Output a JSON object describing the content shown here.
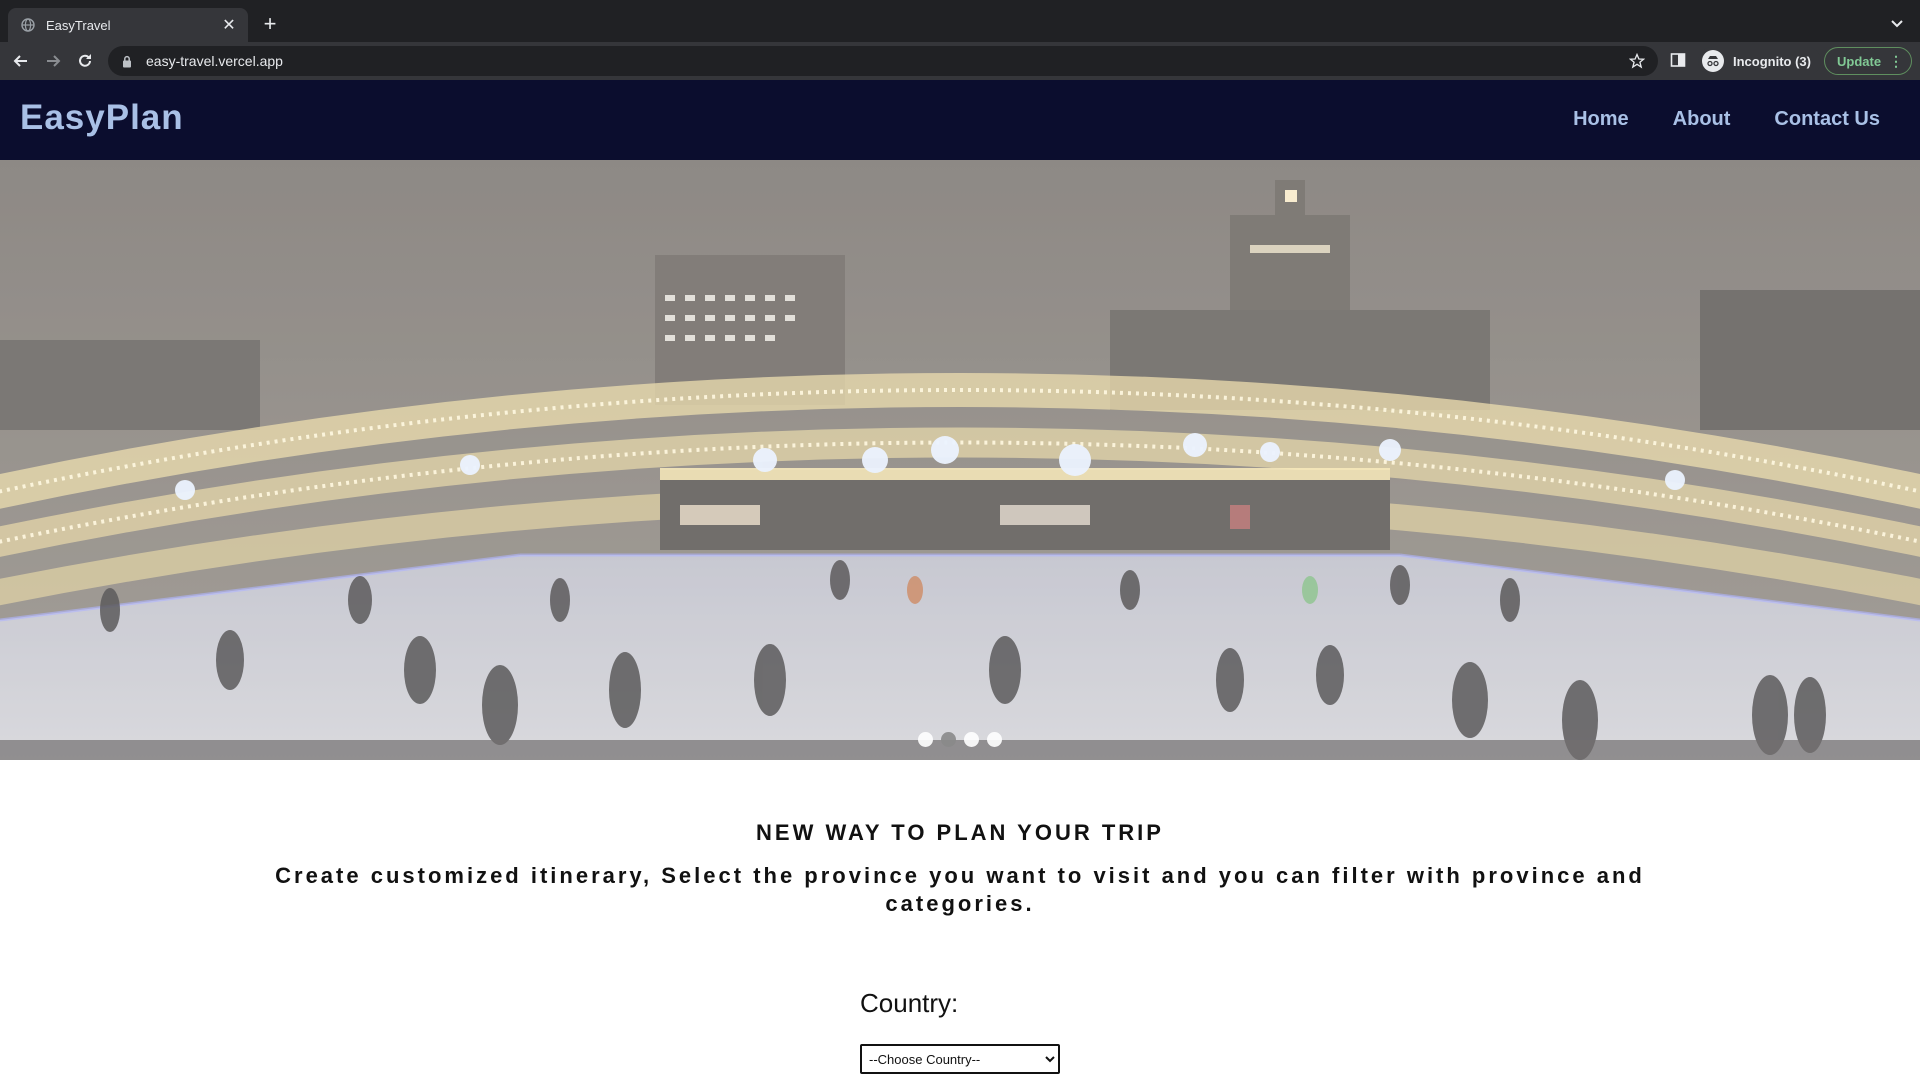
{
  "browser": {
    "tab_title": "EasyTravel",
    "url": "easy-travel.vercel.app",
    "profile_label": "Incognito (3)",
    "update_label": "Update",
    "icons": [
      "globe-icon",
      "close-icon",
      "plus-icon",
      "chevron-down-icon",
      "back-arrow-icon",
      "forward-arrow-icon",
      "reload-icon",
      "lock-icon",
      "star-icon",
      "side-panel-icon",
      "incognito-icon",
      "more-vert-icon"
    ]
  },
  "site": {
    "logo": "EasyPlan",
    "nav": [
      "Home",
      "About",
      "Contact Us"
    ],
    "colors": {
      "header_bg": "#0b0d2e",
      "nav_text": "#a9c0e6"
    }
  },
  "hero": {
    "slides": 4,
    "active_slide_index": 1
  },
  "content": {
    "headline": "NEW WAY TO PLAN YOUR TRIP",
    "subtext": "Create customized itinerary, Select the province you want to visit and you can filter with province and categories.",
    "country_label": "Country:",
    "country_select_value": "--Choose Country--"
  }
}
